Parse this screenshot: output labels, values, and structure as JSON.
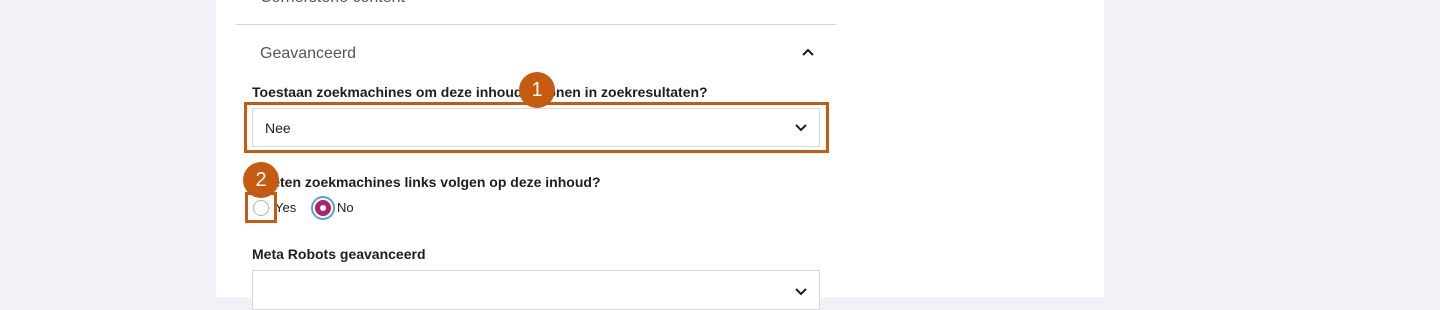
{
  "previous_section": {
    "label": "Cornerstone content"
  },
  "advanced_section": {
    "title": "Geavanceerd",
    "icon": "chevron-up-icon"
  },
  "allow_search": {
    "label": "Toestaan zoekmachines om deze inhoud te tonen in zoekresultaten?",
    "selected_value": "Nee",
    "icon": "chevron-down-icon"
  },
  "follow_links": {
    "label": "Moeten zoekmachines links volgen op deze inhoud?",
    "options": [
      {
        "label": "Yes",
        "checked": false
      },
      {
        "label": "No",
        "checked": true
      }
    ]
  },
  "meta_robots": {
    "label": "Meta Robots geavanceerd",
    "selected_value": "",
    "icon": "chevron-down-icon"
  },
  "annotations": {
    "step1": "1",
    "step2": "2",
    "color": "#c55a11"
  },
  "colors": {
    "radio_checked": "#a4286a",
    "focus_ring": "#5b9dd9",
    "background": "#f1f2f7"
  }
}
